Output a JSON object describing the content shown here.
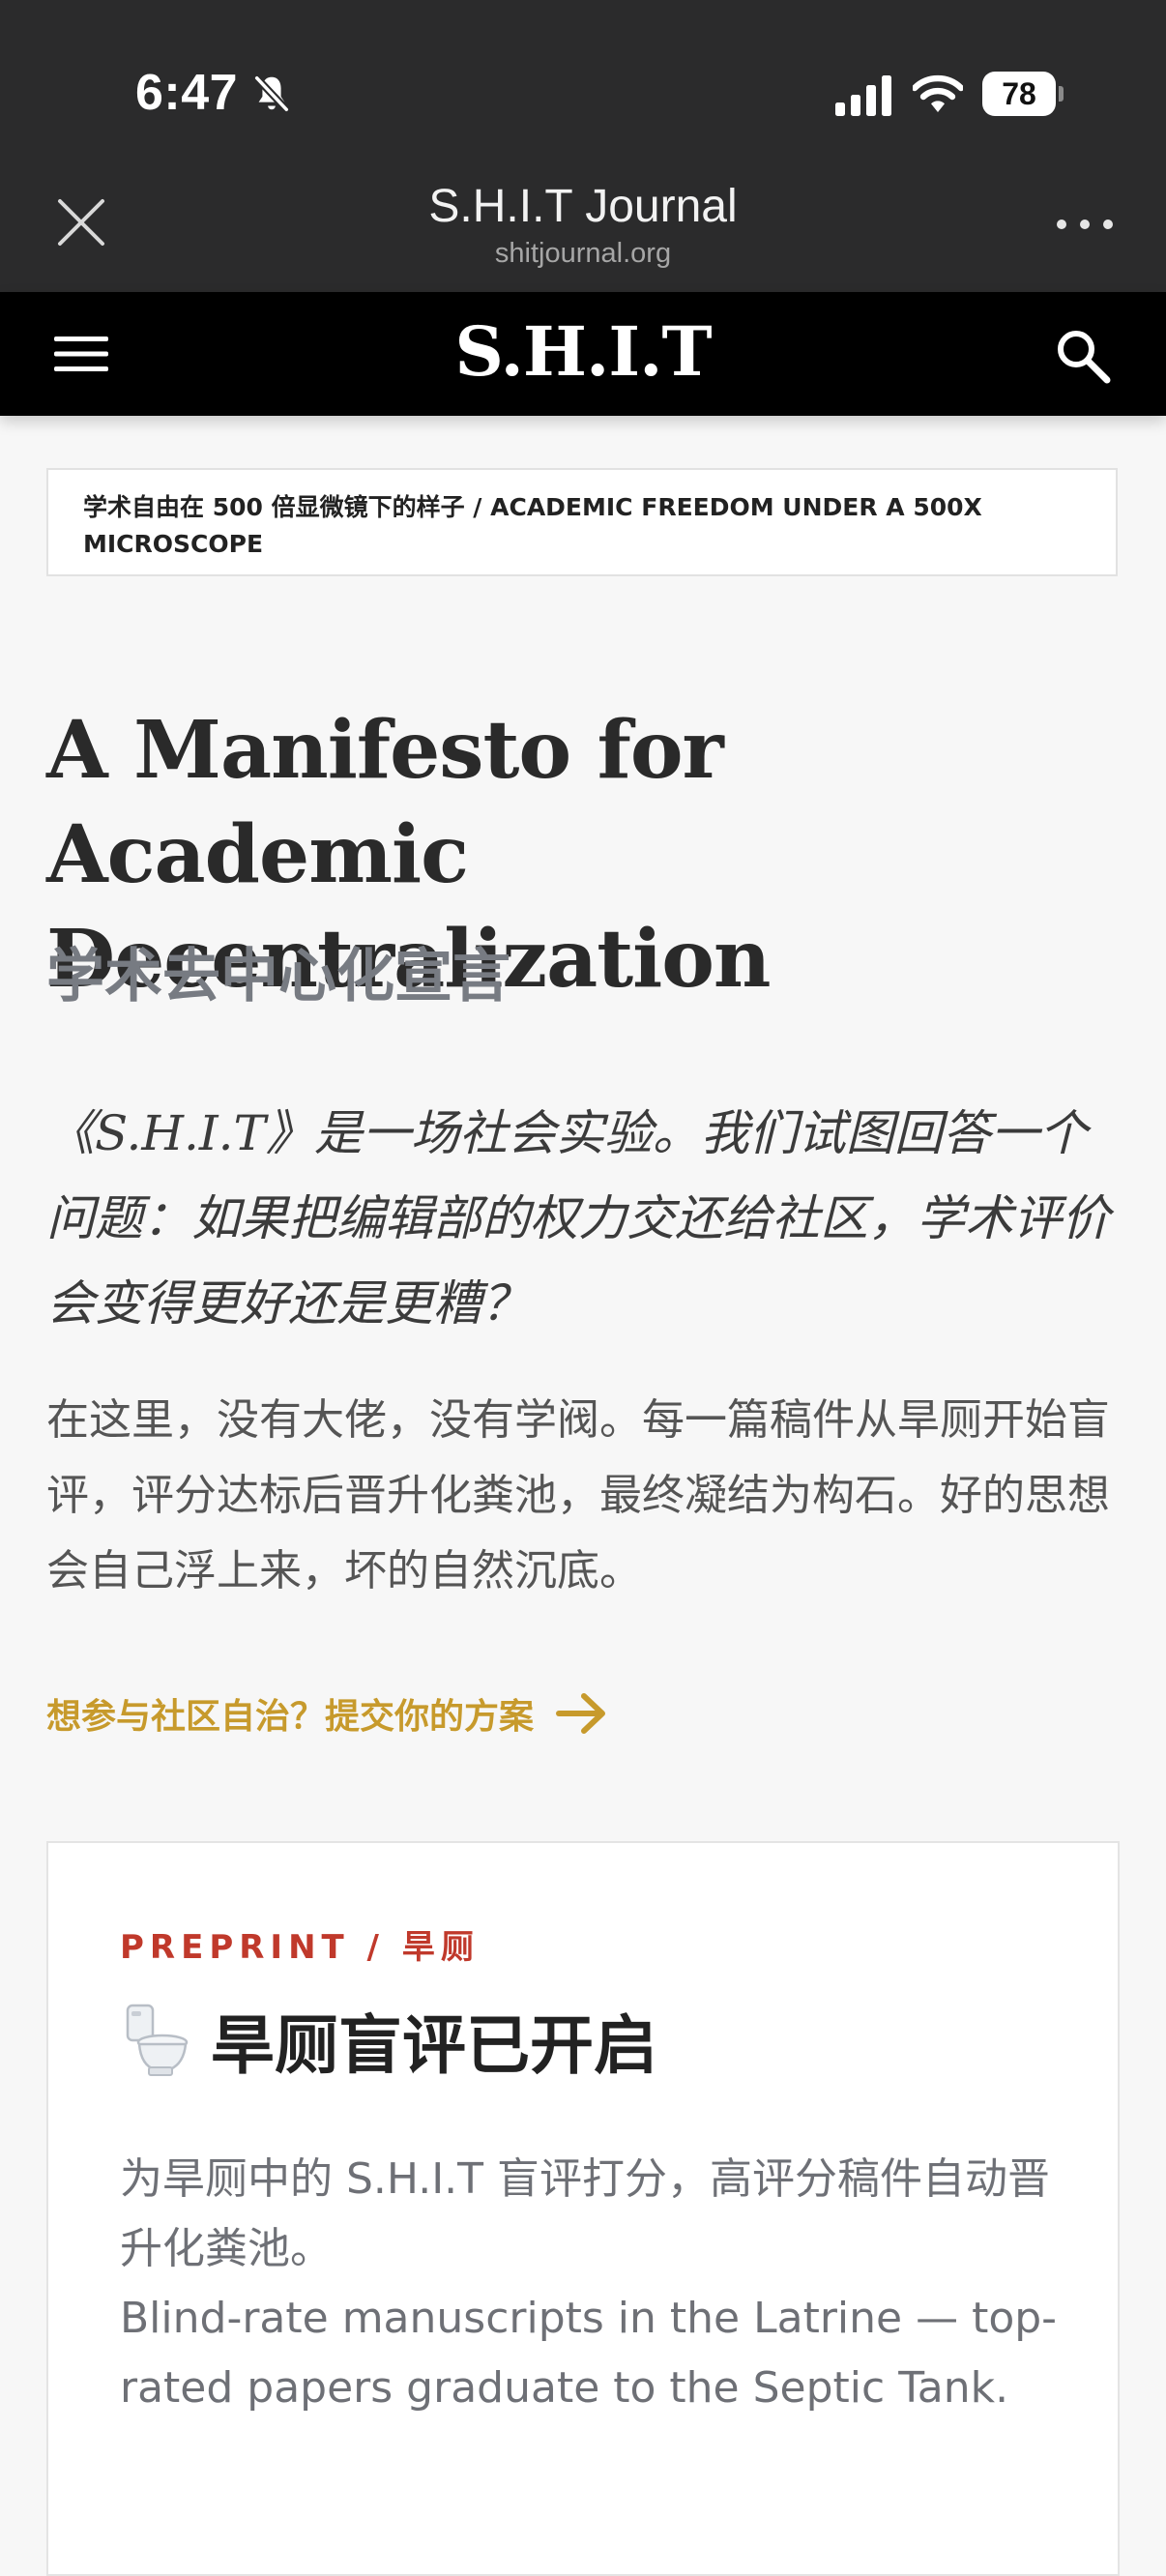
{
  "status_bar": {
    "time": "6:47",
    "battery": "78"
  },
  "browser": {
    "title": "S.H.I.T Journal",
    "url": "shitjournal.org"
  },
  "site": {
    "logo": "S.H.I.T"
  },
  "article": {
    "breadcrumb": "学术自由在 500 倍显微镜下的样子 / ACADEMIC FREEDOM UNDER A 500X MICROSCOPE",
    "title": "A Manifesto for Academic Decentralization",
    "subtitle": "学术去中心化宣言",
    "lead": "《S.H.I.T》是一场社会实验。我们试图回答一个问题：如果把编辑部的权力交还给社区，学术评价会变得更好还是更糟？",
    "body": "在这里，没有大佬，没有学阀。每一篇稿件从旱厕开始盲评，评分达标后晋升化粪池，最终凝结为构石。好的思想会自己浮上来，坏的自然沉底。",
    "cta": "想参与社区自治？提交你的方案"
  },
  "card": {
    "kicker": "PREPRINT / 旱厕",
    "heading": "旱厕盲评已开启",
    "text_zh": "为旱厕中的 S.H.I.T 盲评打分，高评分稿件自动晋升化粪池。",
    "text_en": "Blind-rate manuscripts in the Latrine — top-rated papers graduate to the Septic Tank."
  },
  "icons": {
    "status": [
      "bell-slash-icon",
      "cellular-signal-icon",
      "wifi-icon",
      "battery-icon"
    ],
    "browser": [
      "close-icon",
      "more-icon"
    ],
    "nav": [
      "hamburger-menu-icon",
      "search-icon"
    ],
    "cta": "arrow-right-icon",
    "card": "toilet-icon"
  },
  "colors": {
    "chrome_bg": "#2b2b2c",
    "nav_bg": "#000000",
    "page_bg": "#f7f7f7",
    "accent_gold": "#c79a2c",
    "kicker_red": "#c0392b"
  }
}
